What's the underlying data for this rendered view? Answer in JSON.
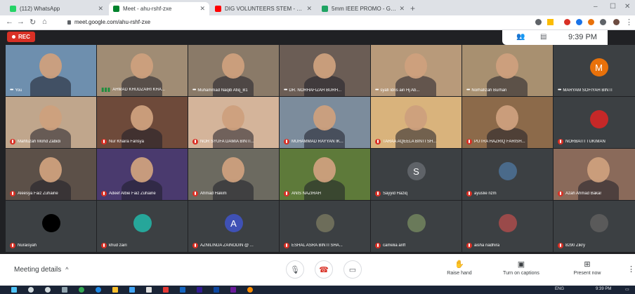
{
  "browser": {
    "tabs": [
      {
        "title": "(112) WhatsApp",
        "active": false,
        "color": "#25d366"
      },
      {
        "title": "Meet - ahu-rshf-zxe",
        "active": true,
        "color": "#00832d"
      },
      {
        "title": "DIG VOLUNTEERS STEM - YouTub",
        "active": false,
        "color": "#ff0000"
      },
      {
        "title": "5mm IEEE PROMO - Google Dri",
        "active": false,
        "color": "#1fa463"
      }
    ],
    "url": "meet.google.com/ahu-rshf-zxe"
  },
  "meet": {
    "rec_label": "REC",
    "clock": "9:39 PM",
    "participants": [
      {
        "name": "You",
        "indicator": "dots",
        "bg": "#6e8fae"
      },
      {
        "name": "AHMAD KHUDZAIRI KHA...",
        "indicator": "wave",
        "bg": "#a08c74"
      },
      {
        "name": "Muhammad Naqib Afiq_B1",
        "indicator": "dots",
        "bg": "#8a7a68"
      },
      {
        "name": "DR. NORHAFIZAH BURH...",
        "indicator": "dots",
        "bg": "#6b5d55"
      },
      {
        "name": "syafi Idris ain Hj Ab...",
        "indicator": "dots",
        "bg": "#b89a7a"
      },
      {
        "name": "Norhafizah Burhan",
        "indicator": "dots",
        "bg": "#a89070"
      },
      {
        "name": "MARYAM SOFIYAH BINTI",
        "indicator": "dots",
        "avatar_letter": "M",
        "avatar_color": "#e8710a",
        "bg": "#3c4043"
      },
      {
        "name": "Mahfuzah Mohd Zabidi",
        "indicator": "mic",
        "bg": "#c0a68c"
      },
      {
        "name": "Nur Khaira Farisya",
        "indicator": "mic",
        "bg": "#6e4a3a"
      },
      {
        "name": "NOR SYUFA DAMIA BINTI...",
        "indicator": "mic",
        "bg": "#d4b49a"
      },
      {
        "name": "MUHAMMAD RAYYAN IK...",
        "indicator": "mic",
        "bg": "#7c8c9c"
      },
      {
        "name": "TARAA AQEELA BINTI SH...",
        "indicator": "mic",
        "bg": "#d9b37c"
      },
      {
        "name": "PUTRA HAZRIQ FARISH...",
        "indicator": "mic",
        "bg": "#8c6a4a"
      },
      {
        "name": "NORBAITI TUKIMAN",
        "indicator": "mic",
        "avatar_letter": "",
        "avatar_color": "#c62828",
        "bg": "#3c4043"
      },
      {
        "name": "Aleesya Faiz Zuhairie",
        "indicator": "mic",
        "bg": "#5c5048"
      },
      {
        "name": "Adeef Albie Faiz Zuhairie",
        "indicator": "mic",
        "bg": "#4a3a6e"
      },
      {
        "name": "Ahmad Hakim",
        "indicator": "mic",
        "bg": "#6c6a60"
      },
      {
        "name": "ANIS NAZIRAH",
        "indicator": "mic",
        "bg": "#5e7a3a"
      },
      {
        "name": "Sayyid Haziq",
        "indicator": "mic",
        "avatar_letter": "S",
        "avatar_color": "#5f6368",
        "bg": "#3c4043"
      },
      {
        "name": "ayuslie nzm",
        "indicator": "mic",
        "avatar_letter": "",
        "avatar_color": "#4a6a8a",
        "bg": "#3c4043"
      },
      {
        "name": "Azah Ahmad Bakar",
        "indicator": "mic",
        "bg": "#8a6a5a"
      },
      {
        "name": "Nuraisyah",
        "indicator": "mic",
        "avatar_letter": "",
        "avatar_color": "#000000",
        "bg": "#3c4043"
      },
      {
        "name": "khud zairi",
        "indicator": "mic",
        "avatar_letter": "",
        "avatar_color": "#26a69a",
        "bg": "#3c4043"
      },
      {
        "name": "AZNILINDA ZAINODIN @ ...",
        "indicator": "mic",
        "avatar_letter": "A",
        "avatar_color": "#3f51b5",
        "bg": "#3c4043"
      },
      {
        "name": "ESHAL ASRA BINTI SHA...",
        "indicator": "mic",
        "avatar_letter": "",
        "avatar_color": "#6d6d5a",
        "bg": "#3c4043"
      },
      {
        "name": "camelia ariff",
        "indicator": "mic",
        "avatar_letter": "",
        "avatar_color": "#6a7a5a",
        "bg": "#3c4043"
      },
      {
        "name": "aisha nadhira",
        "indicator": "mic",
        "avatar_letter": "",
        "avatar_color": "#9a4a4a",
        "bg": "#3c4043"
      },
      {
        "name": "8290 Zikry",
        "indicator": "mic",
        "avatar_letter": "",
        "avatar_color": "#5a5a5a",
        "bg": "#3c4043"
      }
    ],
    "meeting_details_label": "Meeting details",
    "raise_hand_label": "Raise hand",
    "captions_label": "Turn on captions",
    "present_label": "Present now"
  },
  "taskbar": {
    "tray_lang": "ENG",
    "tray_time": "9:39 PM"
  }
}
